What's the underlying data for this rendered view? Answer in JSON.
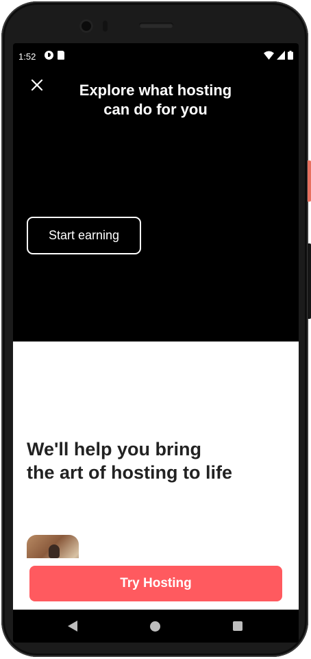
{
  "status_bar": {
    "time": "1:52",
    "left_icons": [
      "data-saver-icon",
      "sd-card-icon"
    ],
    "right_icons": [
      "wifi-icon",
      "signal-icon",
      "battery-icon"
    ]
  },
  "header": {
    "close_icon": "close-icon",
    "title_line1": "Explore what hosting",
    "title_line2": "can do for you"
  },
  "hero": {
    "start_earning_label": "Start earning"
  },
  "content": {
    "heading_line1": "We'll help you bring",
    "heading_line2": "the art of hosting to life"
  },
  "cta": {
    "try_hosting_label": "Try Hosting",
    "color": "#ff5a5f"
  },
  "nav_bar": {
    "icons": [
      "back-icon",
      "home-icon",
      "recents-icon"
    ]
  }
}
